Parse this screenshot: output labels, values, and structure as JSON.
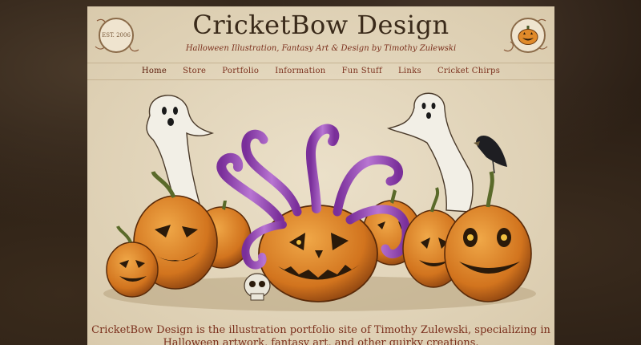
{
  "header": {
    "title": "CricketBow Design",
    "tagline": "Halloween Illustration, Fantasy Art & Design by Timothy Zulewski",
    "badge_left_text": "EST. 2006",
    "badge_right_icon": "jack-o-lantern-icon"
  },
  "nav": {
    "items": [
      {
        "label": "Home"
      },
      {
        "label": "Store"
      },
      {
        "label": "Portfolio"
      },
      {
        "label": "Information"
      },
      {
        "label": "Fun Stuff"
      },
      {
        "label": "Links"
      },
      {
        "label": "Cricket Chirps"
      }
    ]
  },
  "hero": {
    "illustration": "halloween-pumpkins-ghosts-tentacles"
  },
  "intro": {
    "text": "CricketBow Design is the illustration portfolio site of Timothy Zulewski, specializing in Halloween artwork, fantasy art, and other quirky creations."
  },
  "colors": {
    "page_bg": "#e3d6bd",
    "accent": "#7a2f1c",
    "title": "#3a2a1a",
    "pumpkin": "#d9822b",
    "tentacle": "#9b4fb8"
  }
}
